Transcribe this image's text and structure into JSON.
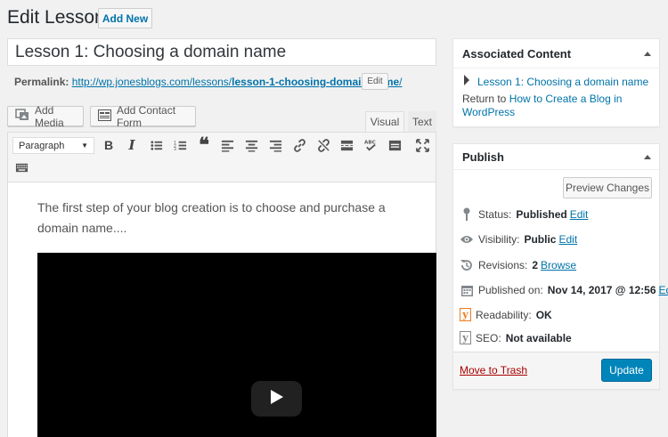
{
  "header": {
    "title": "Edit Lesson",
    "add_new": "Add New"
  },
  "post": {
    "title": "Lesson 1: Choosing a domain name",
    "permalink_label": "Permalink:",
    "permalink_base": "http://wp.jonesblogs.com/lessons/",
    "permalink_slug": "lesson-1-choosing-domain-name",
    "permalink_end": "/",
    "permalink_edit": "Edit"
  },
  "media": {
    "add_media": "Add Media",
    "add_contact_form": "Add Contact Form"
  },
  "editor_tabs": {
    "visual": "Visual",
    "text": "Text"
  },
  "toolbar": {
    "format": "Paragraph",
    "buttons": [
      "bold-icon",
      "italic-icon",
      "bulleted-list-icon",
      "numbered-list-icon",
      "blockquote-icon",
      "align-left-icon",
      "align-center-icon",
      "align-right-icon",
      "insert-link-icon",
      "remove-link-icon",
      "read-more-icon",
      "spellcheck-icon",
      "toggle-toolbar-icon",
      "fullscreen-icon",
      "keyboard-icon"
    ]
  },
  "content": {
    "text": "The first step of your blog creation is to choose and purchase a domain name...."
  },
  "associated": {
    "heading": "Associated Content",
    "item": "Lesson 1: Choosing a domain name",
    "return_prefix": "Return to ",
    "return_link": "How to Create a Blog in WordPress"
  },
  "publish": {
    "heading": "Publish",
    "preview": "Preview Changes",
    "status_label": "Status:",
    "status_value": "Published",
    "visibility_label": "Visibility:",
    "visibility_value": "Public",
    "revisions_label": "Revisions:",
    "revisions_value": "2",
    "browse": "Browse",
    "published_label": "Published on:",
    "published_value": "Nov 14, 2017 @ 12:56",
    "edit": "Edit",
    "readability_label": "Readability:",
    "readability_value": "OK",
    "seo_label": "SEO:",
    "seo_value": "Not available",
    "trash": "Move to Trash",
    "update": "Update"
  },
  "colors": {
    "accent": "#0073aa",
    "primary_button": "#0085ba",
    "danger": "#a00"
  }
}
